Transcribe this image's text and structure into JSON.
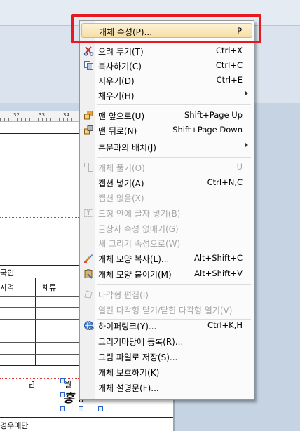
{
  "document": {
    "ruler_numbers": [
      "32",
      "33",
      "34"
    ],
    "cells": {
      "nationality": "국인",
      "qualification": "자격",
      "stay": "체류",
      "year": "년",
      "month": "월",
      "only_case": "경우에만"
    }
  },
  "colors": {
    "highlight_annotation": "#e8181e",
    "menu_hover_bg": "#f6dfa6",
    "disabled_text": "#a7a7a7"
  },
  "context_menu": {
    "items": [
      {
        "label": "개체 속성(P)...",
        "shortcut": "P",
        "icon": "",
        "enabled": true,
        "highlighted": true
      },
      {
        "label": "오려 두기(T)",
        "shortcut": "Ctrl+X",
        "icon": "scissors-icon",
        "enabled": true
      },
      {
        "label": "복사하기(C)",
        "shortcut": "Ctrl+C",
        "icon": "copy-icon",
        "enabled": true
      },
      {
        "label": "지우기(D)",
        "shortcut": "Ctrl+E",
        "icon": "",
        "enabled": true
      },
      {
        "label": "채우기(H)",
        "shortcut": "",
        "icon": "",
        "enabled": true,
        "submenu": true
      },
      {
        "label": "맨 앞으로(U)",
        "shortcut": "Shift+Page Up",
        "icon": "bring-to-front-icon",
        "enabled": true
      },
      {
        "label": "맨 뒤로(N)",
        "shortcut": "Shift+Page Down",
        "icon": "send-to-back-icon",
        "enabled": true
      },
      {
        "label": "본문과의 배치(J)",
        "shortcut": "",
        "icon": "",
        "enabled": true,
        "submenu": true
      },
      {
        "label": "개체 풀기(O)",
        "shortcut": "U",
        "icon": "ungroup-icon",
        "enabled": false
      },
      {
        "label": "캡션 넣기(A)",
        "shortcut": "Ctrl+N,C",
        "icon": "",
        "enabled": true
      },
      {
        "label": "캡션 없음(X)",
        "shortcut": "",
        "icon": "",
        "enabled": false
      },
      {
        "label": "도형 안에 글자 넣기(B)",
        "shortcut": "",
        "icon": "text-in-shape-icon",
        "enabled": false
      },
      {
        "label": "글상자 속성 없애기(G)",
        "shortcut": "",
        "icon": "",
        "enabled": false
      },
      {
        "label": "새 그리기 속성으로(W)",
        "shortcut": "",
        "icon": "",
        "enabled": false
      },
      {
        "label": "개체 모양 복사(L)...",
        "shortcut": "Alt+Shift+C",
        "icon": "copy-shape-icon",
        "enabled": true
      },
      {
        "label": "개체 모양 붙이기(M)",
        "shortcut": "Alt+Shift+V",
        "icon": "paste-shape-icon",
        "enabled": true
      },
      {
        "label": "다각형 편집(I)",
        "shortcut": "",
        "icon": "polygon-edit-icon",
        "enabled": false
      },
      {
        "label": "열린 다각형 닫기/닫힌 다각형 열기(V)",
        "shortcut": "",
        "icon": "",
        "enabled": false
      },
      {
        "label": "하이퍼링크(Y)...",
        "shortcut": "Ctrl+K,H",
        "icon": "hyperlink-icon",
        "enabled": true
      },
      {
        "label": "그리기마당에 등록(R)...",
        "shortcut": "",
        "icon": "",
        "enabled": true
      },
      {
        "label": "그림 파일로 저장(S)...",
        "shortcut": "",
        "icon": "",
        "enabled": true
      },
      {
        "label": "개체 보호하기(K)",
        "shortcut": "",
        "icon": "",
        "enabled": true
      },
      {
        "label": "개체 설명문(F)...",
        "shortcut": "",
        "icon": "",
        "enabled": true
      }
    ]
  }
}
